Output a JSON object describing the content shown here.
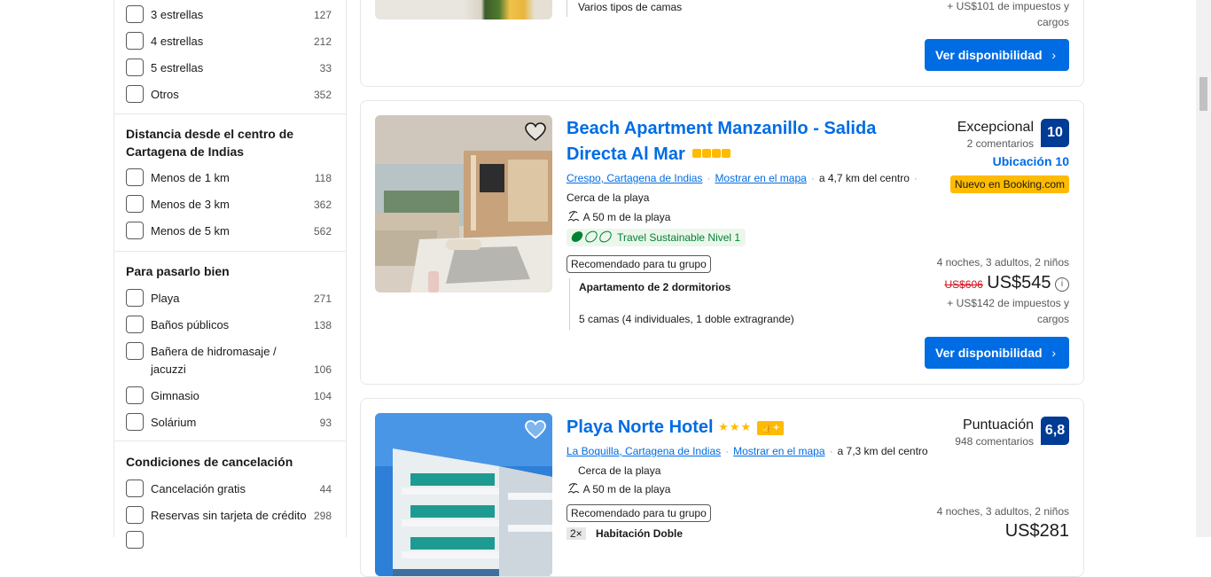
{
  "filters": {
    "stars_items": [
      {
        "label": "3 estrellas",
        "count": "127"
      },
      {
        "label": "4 estrellas",
        "count": "212"
      },
      {
        "label": "5 estrellas",
        "count": "33"
      },
      {
        "label": "Otros",
        "count": "352"
      }
    ],
    "distance": {
      "title": "Distancia desde el centro de Cartagena de Indias",
      "items": [
        {
          "label": "Menos de 1 km",
          "count": "118"
        },
        {
          "label": "Menos de 3 km",
          "count": "362"
        },
        {
          "label": "Menos de 5 km",
          "count": "562"
        }
      ]
    },
    "fun": {
      "title": "Para pasarlo bien",
      "items": [
        {
          "label": "Playa",
          "count": "271"
        },
        {
          "label": "Baños públicos",
          "count": "138"
        },
        {
          "label": "Bañera de hidromasaje / jacuzzi",
          "count": "106"
        },
        {
          "label": "Gimnasio",
          "count": "104"
        },
        {
          "label": "Solárium",
          "count": "93"
        }
      ]
    },
    "cancel": {
      "title": "Condiciones de cancelación",
      "items": [
        {
          "label": "Cancelación gratis",
          "count": "44"
        },
        {
          "label": "Reservas sin tarjeta de crédito",
          "count": "298"
        }
      ]
    }
  },
  "card0": {
    "beds": "Varios tipos de camas",
    "taxes_line1": "+ US$101 de impuestos y",
    "taxes_line2": "cargos",
    "button": "Ver disponibilidad"
  },
  "card1": {
    "title_line1": "Beach Apartment Manzanillo - Salida",
    "title_line2": "Directa Al Mar",
    "stars": "■■■■",
    "location": "Crespo, Cartagena de Indias",
    "map_link": "Mostrar en el mapa",
    "distance": "a 4,7 km del centro",
    "near_beach": "Cerca de la playa",
    "beach_distance": "A 50 m de la playa",
    "sustainable": "Travel Sustainable Nivel 1",
    "recommended": "Recomendado para tu grupo",
    "room_type": "Apartamento de 2 dormitorios",
    "room_beds": "5 camas (4 individuales, 1 doble extragrande)",
    "score_word": "Excepcional",
    "score_count": "2 comentarios",
    "score": "10",
    "location_score": "Ubicación 10",
    "new_badge": "Nuevo en Booking.com",
    "stay": "4 noches, 3 adultos, 2 niños",
    "old_price": "US$606",
    "price": "US$545",
    "taxes_line1": "+ US$142 de impuestos y",
    "taxes_line2": "cargos",
    "button": "Ver disponibilidad"
  },
  "card2": {
    "title": "Playa Norte Hotel",
    "stars": "★★★",
    "location": "La Boquilla, Cartagena de Indias",
    "map_link": "Mostrar en el mapa",
    "distance": "a 7,3 km del centro",
    "near_beach": "Cerca de la playa",
    "beach_distance": "A 50 m de la playa",
    "recommended": "Recomendado para tu grupo",
    "room_qty": "2×",
    "room_type": "Habitación Doble",
    "score_word": "Puntuación",
    "score_count": "948 comentarios",
    "score": "6,8",
    "stay": "4 noches, 3 adultos, 2 niños",
    "price": "US$281"
  }
}
